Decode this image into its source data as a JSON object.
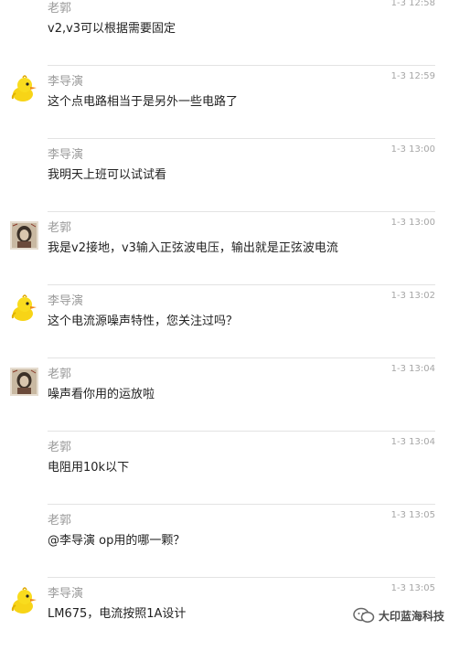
{
  "messages": [
    {
      "name": "老郭",
      "time": "1-3 12:58",
      "text": "v2,v3可以根据需要固定",
      "avatar": "none"
    },
    {
      "name": "李导演",
      "time": "1-3 12:59",
      "text": "这个点电路相当于是另外一些电路了",
      "avatar": "duck-avatar"
    },
    {
      "name": "李导演",
      "time": "1-3 13:00",
      "text": "我明天上班可以试试看",
      "avatar": "none"
    },
    {
      "name": "老郭",
      "time": "1-3 13:00",
      "text": "我是v2接地，v3输入正弦波电压，输出就是正弦波电流",
      "avatar": "portrait-avatar"
    },
    {
      "name": "李导演",
      "time": "1-3 13:02",
      "text": "这个电流源噪声特性，您关注过吗？",
      "avatar": "duck-avatar"
    },
    {
      "name": "老郭",
      "time": "1-3 13:04",
      "text": "噪声看你用的运放啦",
      "avatar": "portrait-avatar"
    },
    {
      "name": "老郭",
      "time": "1-3 13:04",
      "text": "电阻用10k以下",
      "avatar": "none"
    },
    {
      "name": "老郭",
      "time": "1-3 13:05",
      "text": "@李导演 op用的哪一颗？",
      "avatar": "none"
    },
    {
      "name": "李导演",
      "time": "1-3 13:05",
      "text": "LM675，电流按照1A设计",
      "avatar": "duck-avatar"
    }
  ],
  "watermark": {
    "text": "大印蓝海科技",
    "icon": "wechat-logo-icon"
  }
}
